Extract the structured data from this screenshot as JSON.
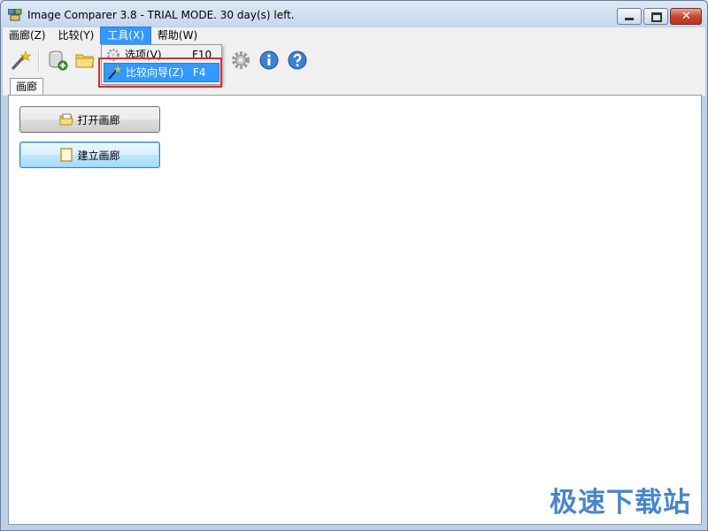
{
  "window": {
    "title": "Image Comparer 3.8 - TRIAL MODE. 30 day(s) left.",
    "close_symbol": "✕"
  },
  "menubar": {
    "items": [
      {
        "label": "画廊(Z)"
      },
      {
        "label": "比较(Y)"
      },
      {
        "label": "工具(X)"
      },
      {
        "label": "帮助(W)"
      }
    ]
  },
  "toolbar": {
    "icons": [
      "magic-wand-icon",
      "new-database-icon",
      "open-folder-icon",
      "settings-gear-icon",
      "info-icon",
      "help-icon"
    ]
  },
  "tools_menu": {
    "items": [
      {
        "label": "选项(V)",
        "shortcut": "F10",
        "icon": "gear-icon"
      },
      {
        "label": "比较向导(Z)",
        "shortcut": "F4",
        "icon": "magic-wand-icon"
      }
    ]
  },
  "tabs": [
    {
      "label": "画廊"
    }
  ],
  "gallery": {
    "open_button": "打开画廊",
    "create_button": "建立画廊"
  },
  "watermark": "极速下载站",
  "colors": {
    "accent": "#3399ff",
    "highlight_border": "#e0282c",
    "watermark": "#2a72c0"
  }
}
